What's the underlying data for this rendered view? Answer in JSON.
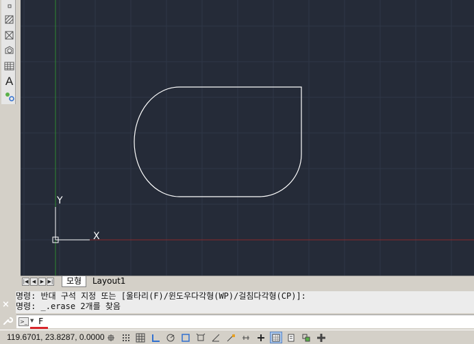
{
  "left_toolbar": {
    "tools": [
      {
        "icon": "dot-icon"
      },
      {
        "icon": "hatch-icon"
      },
      {
        "icon": "gradient-icon"
      },
      {
        "icon": "region-icon"
      },
      {
        "icon": "table-icon"
      },
      {
        "icon": "multiline-text-icon",
        "glyph": "A"
      },
      {
        "icon": "add-selected-icon"
      }
    ]
  },
  "viewport": {
    "background": "#252b38",
    "ucs": {
      "x_label": "X",
      "y_label": "Y"
    }
  },
  "tabs": {
    "model": "모형",
    "layout1": "Layout1"
  },
  "command": {
    "history": [
      "명령: 반대 구석 지정 또는 [울타리(F)/윈도우다각형(WP)/걸침다각형(CP)]:",
      "명령: _.erase 2개를 찾음"
    ],
    "input": "F",
    "close_glyph": "×"
  },
  "status": {
    "coordinates": "119.6701, 23.8287, 0.0000",
    "toggles": [
      {
        "icon": "infer-constraints-icon",
        "on": false
      },
      {
        "icon": "snap-mode-icon",
        "on": false
      },
      {
        "icon": "grid-display-icon",
        "on": false
      },
      {
        "icon": "ortho-mode-icon",
        "on": false
      },
      {
        "icon": "polar-tracking-icon",
        "on": false
      },
      {
        "icon": "object-snap-icon",
        "on": false
      },
      {
        "icon": "3d-object-snap-icon",
        "on": false
      },
      {
        "icon": "object-snap-tracking-icon",
        "on": false
      },
      {
        "icon": "dynamic-ucs-icon",
        "on": false
      },
      {
        "icon": "dynamic-input-icon",
        "on": false
      },
      {
        "icon": "lineweight-icon",
        "on": false
      },
      {
        "icon": "transparency-icon",
        "on": true
      },
      {
        "icon": "quick-properties-icon",
        "on": false
      },
      {
        "icon": "selection-cycling-icon",
        "on": false
      },
      {
        "icon": "annotation-monitor-icon",
        "on": false
      }
    ]
  }
}
